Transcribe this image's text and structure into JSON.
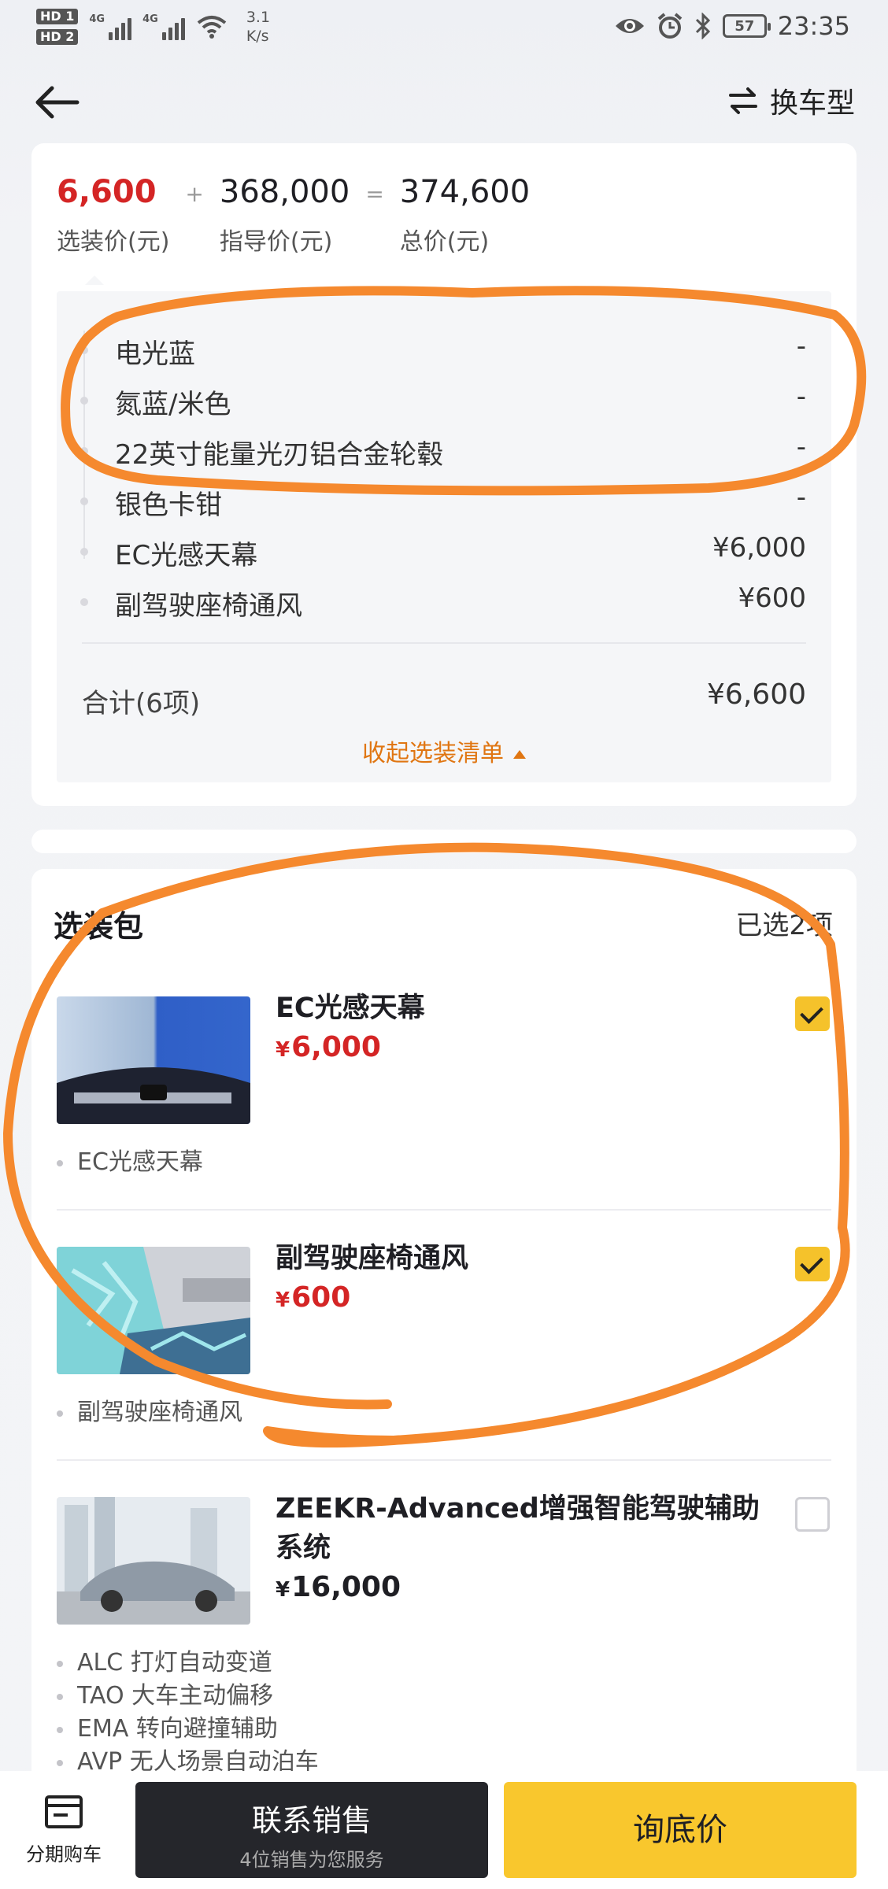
{
  "status_bar": {
    "sim1": "HD 1",
    "sim2": "HD 2",
    "net1": "4G",
    "net2": "4G",
    "speed": "3.1",
    "speed_unit": "K/s",
    "battery": "57",
    "time": "23:35"
  },
  "header": {
    "switch_label": "换车型"
  },
  "summary": {
    "option_price": "6,600",
    "option_price_label": "选装价(元)",
    "plus": "+",
    "guide_price": "368,000",
    "guide_price_label": "指导价(元)",
    "equals": "=",
    "total_price": "374,600",
    "total_price_label": "总价(元)",
    "options": [
      {
        "name": "电光蓝",
        "price": "-"
      },
      {
        "name": "氮蓝/米色",
        "price": "-"
      },
      {
        "name": "22英寸能量光刃铝合金轮毂",
        "price": "-"
      },
      {
        "name": "银色卡钳",
        "price": "-"
      },
      {
        "name": "EC光感天幕",
        "price": "¥6,000"
      },
      {
        "name": "副驾驶座椅通风",
        "price": "¥600"
      }
    ],
    "total_label": "合计(6项)",
    "total_value": "¥6,600",
    "collapse_label": "收起选装清单"
  },
  "packages": {
    "title": "选装包",
    "selected_count": "已选2项",
    "items": [
      {
        "name": "EC光感天幕",
        "currency": "¥",
        "price": "6,000",
        "checked": true,
        "features": [
          "EC光感天幕"
        ]
      },
      {
        "name": "副驾驶座椅通风",
        "currency": "¥",
        "price": "600",
        "checked": true,
        "features": [
          "副驾驶座椅通风"
        ]
      },
      {
        "name": "ZEEKR-Advanced增强智能驾驶辅助系统",
        "currency": "¥",
        "price": "16,000",
        "checked": false,
        "features": [
          "ALC 打灯自动变道",
          "TAO 大车主动偏移",
          "EMA 转向避撞辅助",
          "AVP 无人场景自动泊车"
        ]
      }
    ]
  },
  "bottom_bar": {
    "installment_label": "分期购车",
    "contact_label": "联系销售",
    "contact_sub": "4位销售为您服务",
    "ask_label": "询底价"
  },
  "colors": {
    "accent_red": "#d42525",
    "accent_orange": "#e07612",
    "brand_yellow": "#f9c72d",
    "dark_button": "#25262b",
    "annotation": "#f5892e"
  }
}
